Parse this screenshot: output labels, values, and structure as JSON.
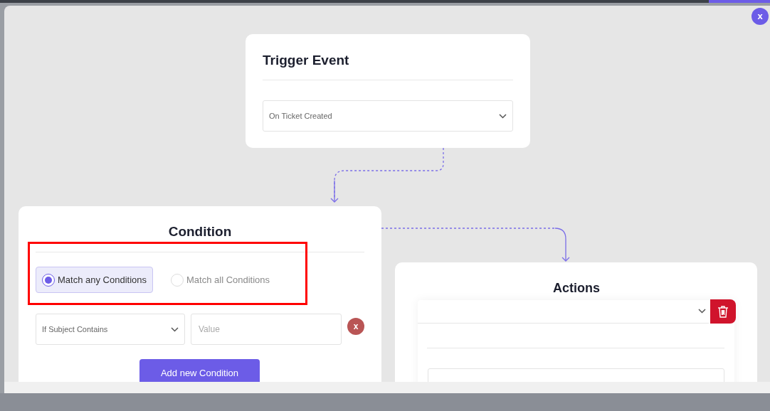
{
  "close_button": "x",
  "trigger": {
    "title": "Trigger Event",
    "event": "On Ticket Created"
  },
  "condition": {
    "title": "Condition",
    "match_options": [
      {
        "label": "Match any Conditions",
        "selected": true
      },
      {
        "label": "Match all Conditions",
        "selected": false
      }
    ],
    "rules": [
      {
        "field": "If Subject Contains",
        "placeholder": "Value",
        "remove": "x"
      }
    ],
    "add_button": "Add new Condition"
  },
  "actions": {
    "title": "Actions"
  }
}
